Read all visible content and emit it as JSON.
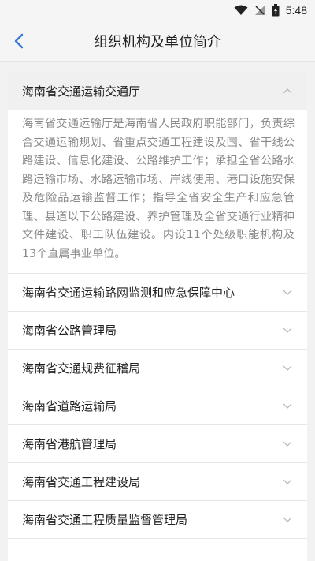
{
  "status_bar": {
    "time": "5:48",
    "icons": [
      "wifi-icon",
      "signal-off-icon",
      "battery-charging-icon"
    ]
  },
  "header": {
    "title": "组织机构及单位简介",
    "back_icon": "chevron-left-icon",
    "accent_color": "#3b7ad8"
  },
  "accordion": {
    "expanded": {
      "title": "海南省交通运输交通厅",
      "description": "海南省交通运输厅是海南省人民政府职能部门，负责综合交通运输规划、省重点交通工程建设及国、省干线公路建设、信息化建设、公路维护工作；承担全省公路水路运输市场、水路运输市场、岸线使用、港口设施安保及危险品运输监督工作；指导全省安全生产和应急管理、县道以下公路建设、养护管理及全省交通行业精神文件建设、职工队伍建设。内设11个处级职能机构及13个直属事业单位。"
    },
    "items": [
      {
        "title": "海南省交通运输路网监测和应急保障中心"
      },
      {
        "title": "海南省公路管理局"
      },
      {
        "title": "海南省交通规费征稽局"
      },
      {
        "title": "海南省道路运输局"
      },
      {
        "title": "海南省港航管理局"
      },
      {
        "title": "海南省交通工程建设局"
      },
      {
        "title": "海南省交通工程质量监督管理局"
      }
    ]
  }
}
